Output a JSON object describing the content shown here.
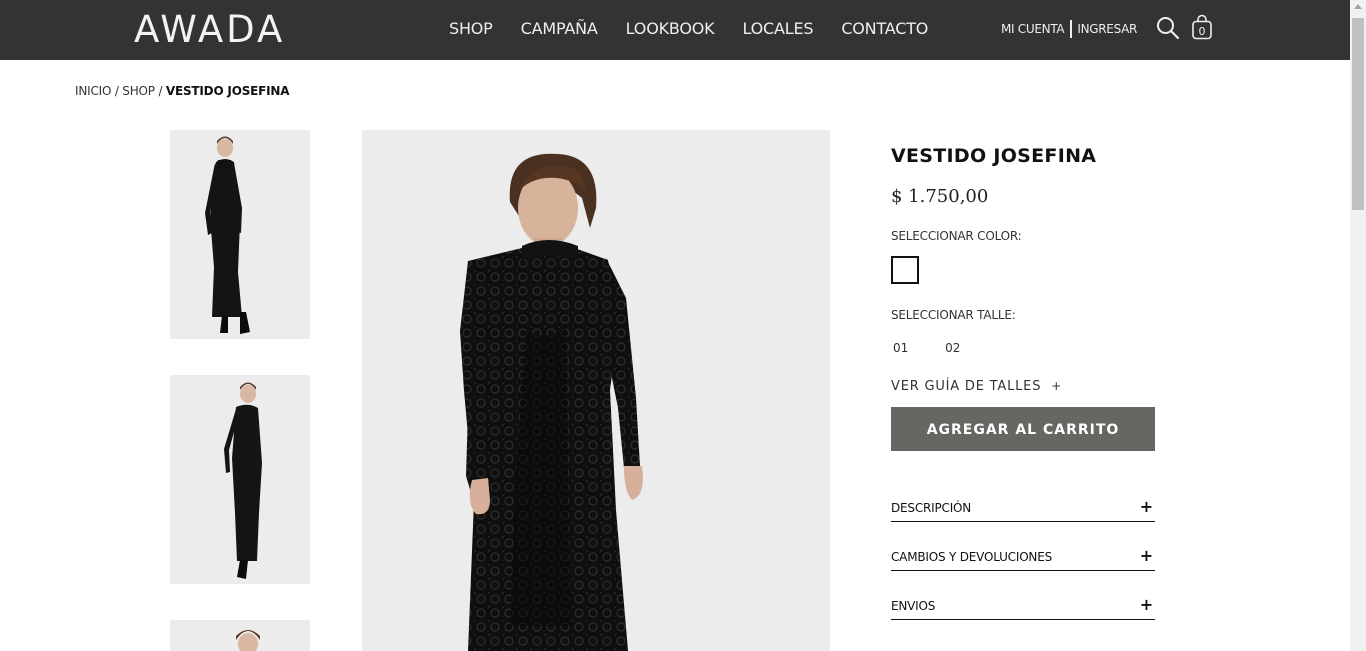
{
  "header": {
    "logo": "AWADA",
    "nav": [
      "SHOP",
      "CAMPAÑA",
      "LOOKBOOK",
      "LOCALES",
      "CONTACTO"
    ],
    "account_label": "MI CUENTA",
    "login_label": "INGRESAR",
    "cart_count": "0",
    "icons": [
      "search-icon",
      "shopping-bag-icon"
    ]
  },
  "breadcrumb": {
    "home": "INICIO",
    "sep1": " / ",
    "shop": "SHOP",
    "sep2": " / ",
    "current": "VESTIDO JOSEFINA"
  },
  "product": {
    "title": "VESTIDO JOSEFINA",
    "price": "$ 1.750,00",
    "color_label": "SELECCIONAR COLOR:",
    "size_label": "SELECCIONAR TALLE:",
    "sizes": [
      "01",
      "02"
    ],
    "size_guide": "VER GUÍA DE TALLES",
    "size_guide_plus": "+",
    "add_to_cart": "AGREGAR AL CARRITO",
    "accordions": [
      {
        "label": "DESCRIPCIÓN",
        "plus": "+"
      },
      {
        "label": "CAMBIOS Y DEVOLUCIONES",
        "plus": "+"
      },
      {
        "label": "ENVIOS",
        "plus": "+"
      }
    ],
    "swatch_color": "#ffffff"
  },
  "colors": {
    "header_bg": "#333331",
    "button_bg": "#666663",
    "image_bg": "#ececec"
  }
}
